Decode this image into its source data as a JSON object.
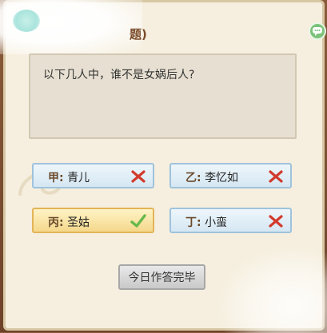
{
  "header": {
    "title_fragment": "题)"
  },
  "question": {
    "text": "以下几人中，谁不是女娲后人?"
  },
  "options": [
    {
      "letter": "甲:",
      "name": "青儿",
      "state": "wrong"
    },
    {
      "letter": "乙:",
      "name": "李忆如",
      "state": "wrong"
    },
    {
      "letter": "丙:",
      "name": "圣姑",
      "state": "correct"
    },
    {
      "letter": "丁:",
      "name": "小蛮",
      "state": "wrong"
    }
  ],
  "finish_button": {
    "label": "今日作答完毕"
  },
  "icons": {
    "wrong": "cross-mark-icon",
    "correct": "check-mark-icon",
    "chat": "chat-bubble-icon"
  },
  "colors": {
    "wrong": "#d23b2d",
    "correct": "#66b84a",
    "option_blue_border": "#9fc3dc",
    "option_yellow_border": "#e2b457"
  }
}
